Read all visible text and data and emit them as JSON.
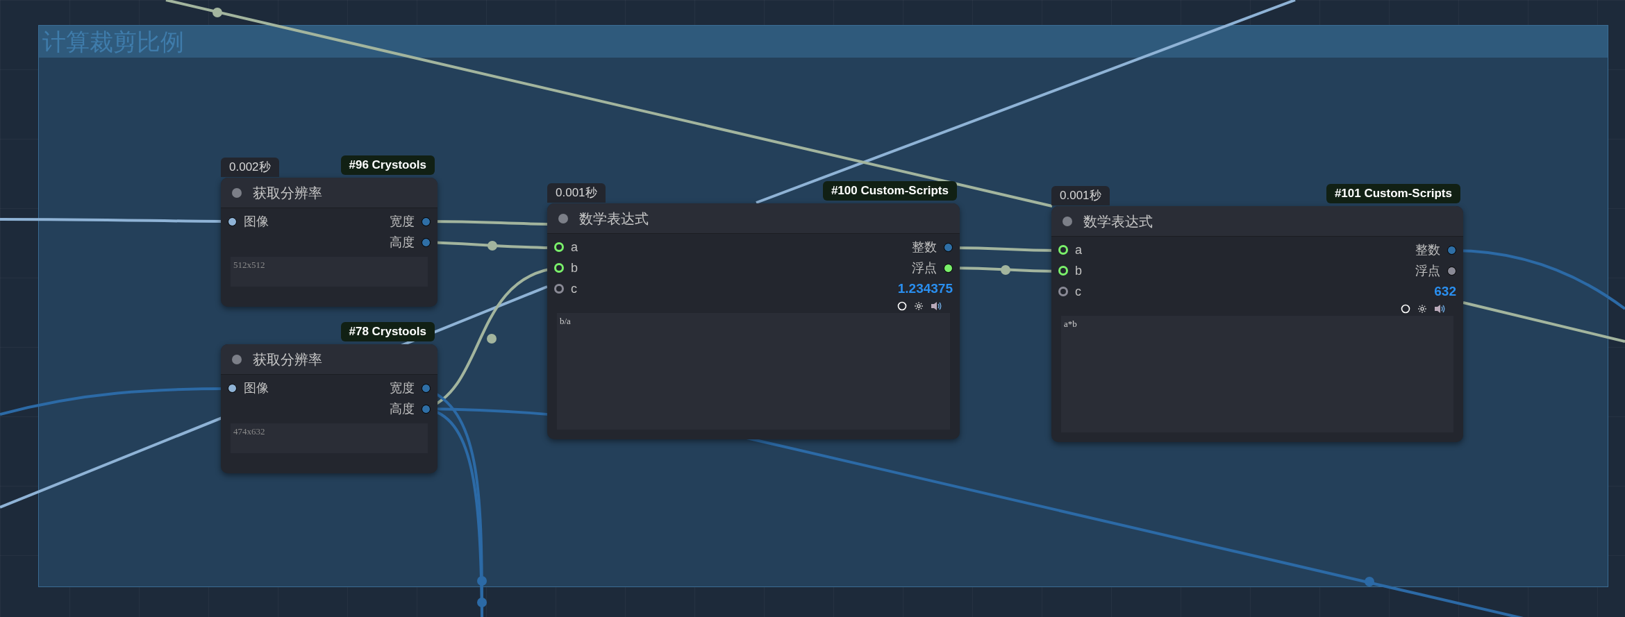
{
  "group": {
    "title": "计算裁剪比例"
  },
  "nodes": [
    {
      "kind": "resolution",
      "timing": "0.002秒",
      "tag": "#96 Crystools",
      "title": "获取分辨率",
      "inputs": [
        {
          "label": "图像",
          "kind": "dot",
          "color": "#8fb3d6"
        }
      ],
      "outputs": [
        {
          "label": "宽度",
          "kind": "dot",
          "color": "#2f6fa6"
        },
        {
          "label": "高度",
          "kind": "dot",
          "color": "#2f6fa6"
        }
      ],
      "text": "512x512"
    },
    {
      "kind": "resolution",
      "tag": "#78 Crystools",
      "title": "获取分辨率",
      "inputs": [
        {
          "label": "图像",
          "kind": "dot",
          "color": "#8fb3d6"
        }
      ],
      "outputs": [
        {
          "label": "宽度",
          "kind": "dot",
          "color": "#2f6fa6"
        },
        {
          "label": "高度",
          "kind": "dot",
          "color": "#2f6fa6"
        }
      ],
      "text": "474x632"
    },
    {
      "kind": "math",
      "timing": "0.001秒",
      "tag": "#100 Custom-Scripts",
      "title": "数学表达式",
      "inputs": [
        {
          "label": "a",
          "kind": "ring",
          "color": "#7af06a"
        },
        {
          "label": "b",
          "kind": "ring",
          "color": "#7af06a"
        },
        {
          "label": "c",
          "kind": "ring",
          "color": "#8a8a96"
        }
      ],
      "outputs": [
        {
          "label": "整数",
          "kind": "dot",
          "color": "#2f6fa6"
        },
        {
          "label": "浮点",
          "kind": "dot",
          "color": "#7af06a"
        }
      ],
      "value": "1.234375",
      "text": "b/a"
    },
    {
      "kind": "math",
      "timing": "0.001秒",
      "tag": "#101 Custom-Scripts",
      "title": "数学表达式",
      "inputs": [
        {
          "label": "a",
          "kind": "ring",
          "color": "#7af06a"
        },
        {
          "label": "b",
          "kind": "ring",
          "color": "#7af06a"
        },
        {
          "label": "c",
          "kind": "ring",
          "color": "#8a8a96"
        }
      ],
      "outputs": [
        {
          "label": "整数",
          "kind": "dot",
          "color": "#2f6fa6"
        },
        {
          "label": "浮点",
          "kind": "dot",
          "color": "#8a8a96"
        }
      ],
      "value": "632",
      "text": "a*b"
    }
  ]
}
